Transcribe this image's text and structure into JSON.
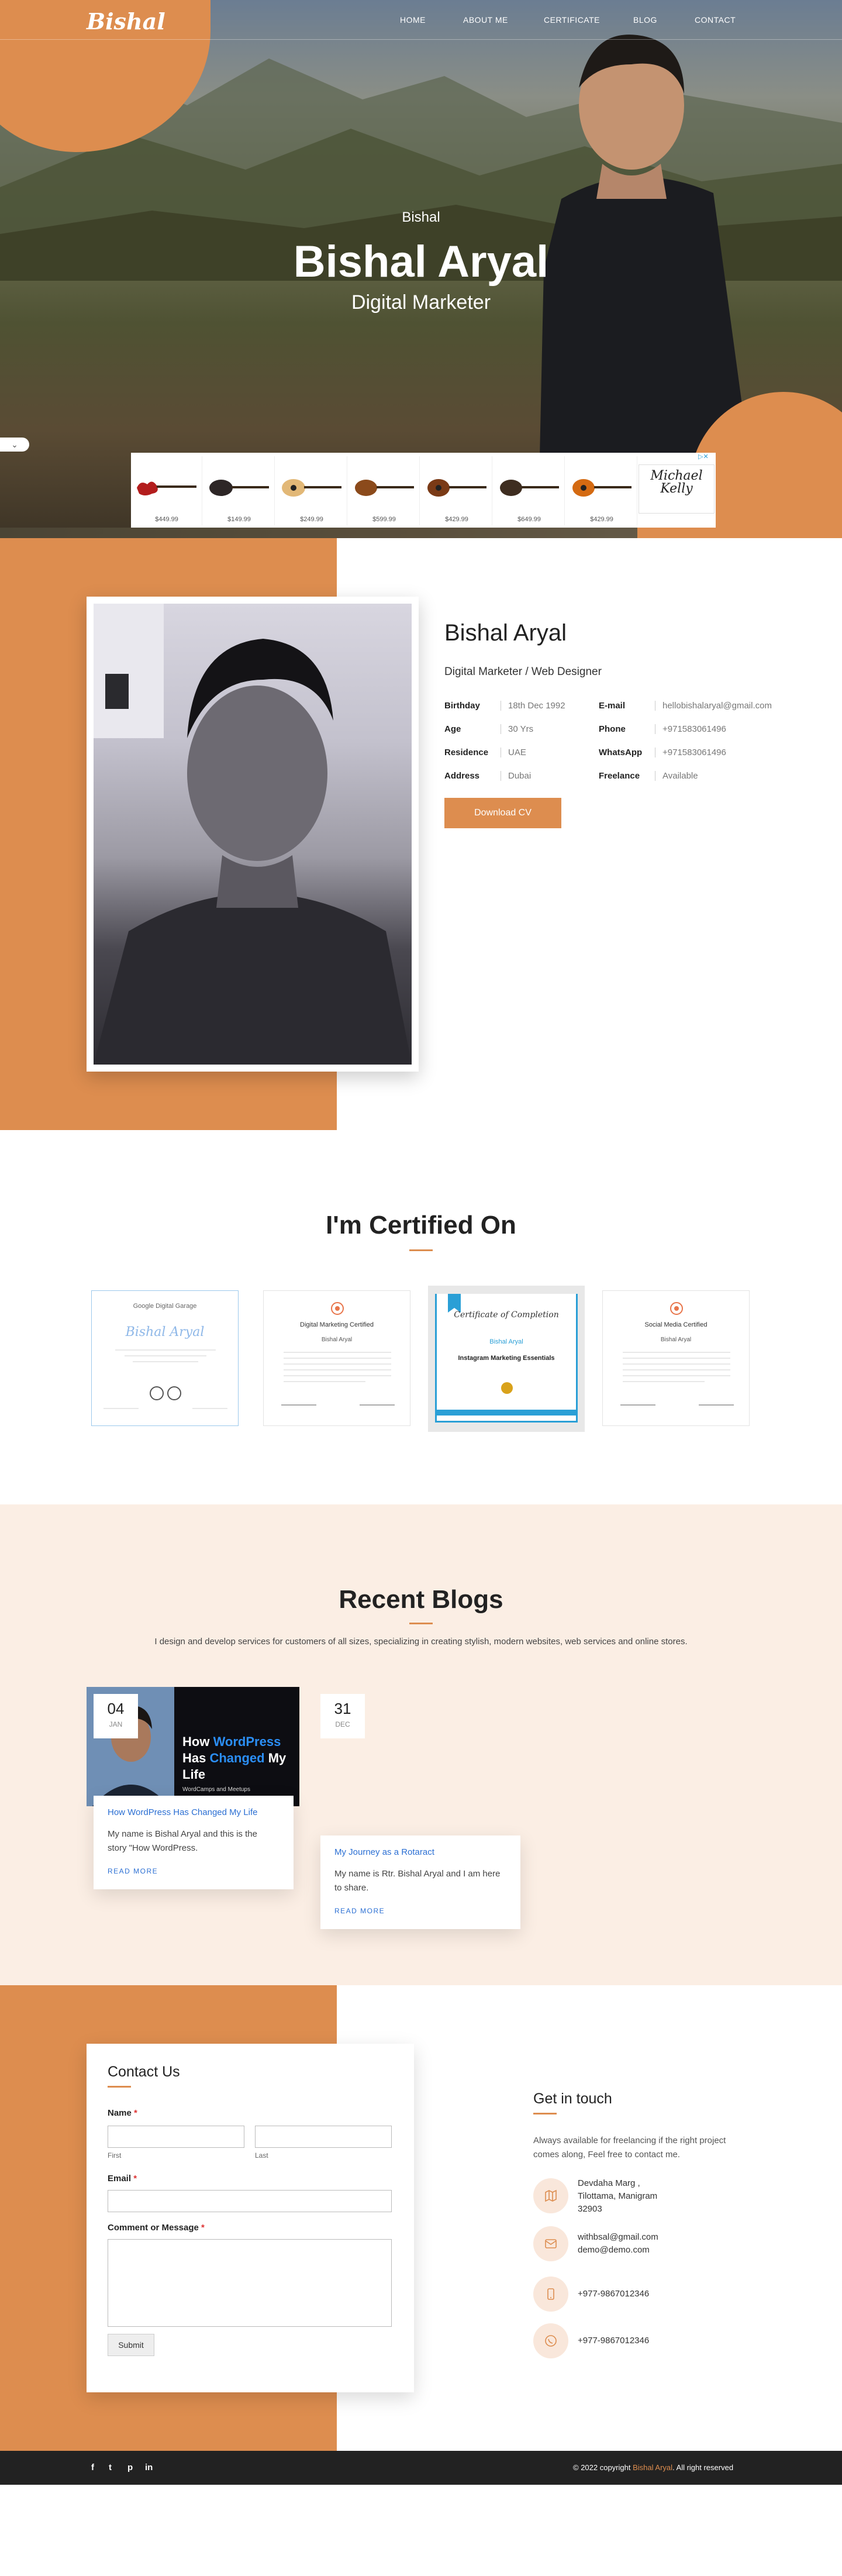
{
  "site": {
    "logo": "Bishal",
    "nav": [
      {
        "label": "HOME"
      },
      {
        "label": "ABOUT ME"
      },
      {
        "label": "CERTIFICATE"
      },
      {
        "label": "BLOG"
      },
      {
        "label": "CONTACT"
      }
    ]
  },
  "hero": {
    "subtitle": "Bishal",
    "title": "Bishal Aryal",
    "role": "Digital Marketer",
    "scroll_icon": "chevron-down-icon"
  },
  "ad": {
    "prices": [
      "$449.99",
      "$149.99",
      "$249.99",
      "$599.99",
      "$429.99",
      "$649.99",
      "$429.99"
    ],
    "brand": "Michael Kelly",
    "adchoices_icon": "ad-choices-icon"
  },
  "about": {
    "name": "Bishal Aryal",
    "role": "Digital Marketer / Web Designer",
    "left_info": [
      {
        "key": "Birthday",
        "value": "18th Dec 1992"
      },
      {
        "key": "Age",
        "value": "30 Yrs"
      },
      {
        "key": "Residence",
        "value": "UAE"
      },
      {
        "key": "Address",
        "value": "Dubai"
      }
    ],
    "right_info": [
      {
        "key": "E-mail",
        "value": "hellobishalaryal@gmail.com"
      },
      {
        "key": "Phone",
        "value": "+971583061496"
      },
      {
        "key": "WhatsApp",
        "value": "+971583061496"
      },
      {
        "key": "Freelance",
        "value": "Available"
      }
    ],
    "cv_button": "Download CV"
  },
  "certificates": {
    "title": "I'm Certified On",
    "items": [
      {
        "heading": "Google Digital Garage",
        "name": "Bishal Aryal"
      },
      {
        "heading": "Digital Marketing Certified",
        "name": "Bishal Aryal"
      },
      {
        "heading": "Certificate of Completion",
        "name": "Bishal Aryal",
        "course": "Instagram Marketing Essentials"
      },
      {
        "heading": "Social Media Certified",
        "name": "Bishal Aryal"
      }
    ]
  },
  "blogs": {
    "title": "Recent Blogs",
    "description": "I design and develop services for customers of all sizes, specializing in creating stylish, modern websites, web services and online stores.",
    "posts": [
      {
        "day": "04",
        "month": "JAN",
        "image_title_parts": [
          "How ",
          "WordPress",
          " Has ",
          "Changed",
          " My Life"
        ],
        "image_footer": "WordCamps and Meetups",
        "title": "How WordPress Has Changed My Life",
        "excerpt": "My name is Bishal Aryal and this is the story \"How WordPress.",
        "read_more": "READ MORE"
      },
      {
        "day": "31",
        "month": "DEC",
        "title": "My Journey as a Rotaract",
        "excerpt": "My name is Rtr. Bishal Aryal and I am here to share.",
        "read_more": "READ MORE"
      }
    ]
  },
  "contact": {
    "title": "Contact Us",
    "name_label": "Name",
    "first_hint": "First",
    "last_hint": "Last",
    "email_label": "Email",
    "comment_label": "Comment or Message",
    "required_mark": "*",
    "submit": "Submit",
    "get_in_touch": "Get in touch",
    "get_in_touch_desc": "Always available for freelancing if the right project comes along, Feel free to contact me.",
    "address_lines": [
      "Devdaha Marg ,",
      "Tilottama, Manigram",
      "32903"
    ],
    "emails": [
      "withbsal@gmail.com",
      "demo@demo.com"
    ],
    "phone": "+977-9867012346",
    "whatsapp": "+977-9867012346"
  },
  "footer": {
    "social": [
      "f",
      "t",
      "p",
      "in"
    ],
    "copyright_prefix": "© 2022 copyright ",
    "copyright_name": "Bishal Aryal",
    "copyright_suffix": ". All right reserved"
  },
  "colors": {
    "accent": "#dd8d4f",
    "link": "#2b6fd3",
    "footer": "#222222"
  }
}
